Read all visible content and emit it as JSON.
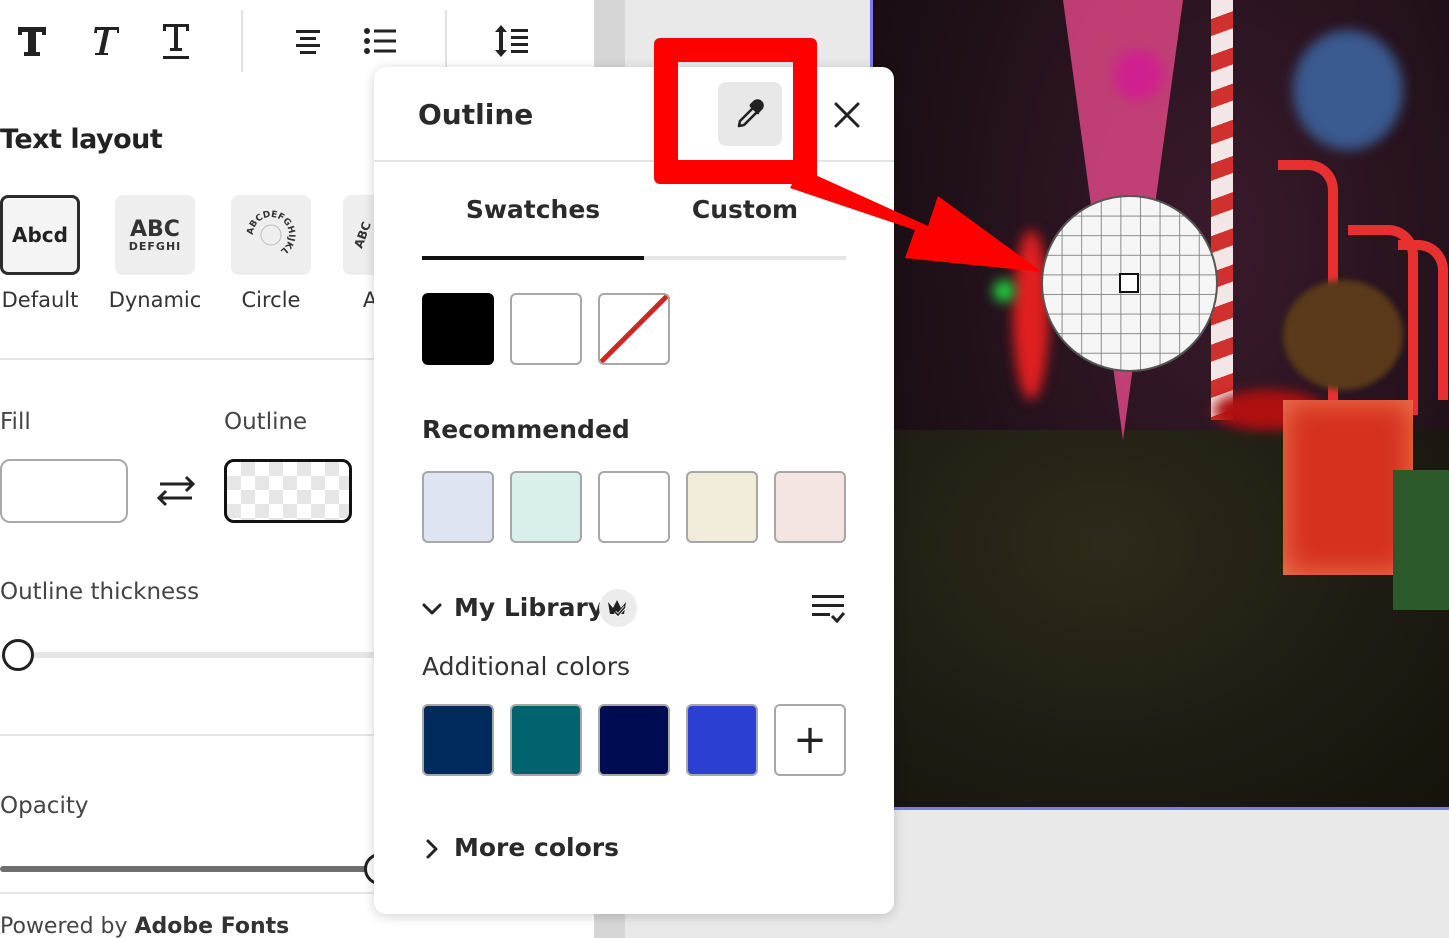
{
  "toolbar": {
    "icons": [
      "bold-text-icon",
      "italic-text-icon",
      "underline-text-icon",
      "align-center-icon",
      "bulleted-list-icon",
      "line-spacing-icon"
    ]
  },
  "text_layout": {
    "title": "Text layout",
    "options": [
      {
        "label": "Default",
        "preview": "Abcd",
        "selected": true
      },
      {
        "label": "Dynamic",
        "preview": "ABC",
        "preview_sub": "DEFGHI",
        "selected": false
      },
      {
        "label": "Circle",
        "preview": "ABCDEFGHIJKL",
        "selected": false
      },
      {
        "label": "A",
        "preview": "ABC",
        "selected": false
      }
    ]
  },
  "fill_outline": {
    "fill_label": "Fill",
    "outline_label": "Outline",
    "fill_color": "#ffffff",
    "outline_color": "transparent"
  },
  "outline_thickness": {
    "label": "Outline thickness",
    "value_fraction": 0.0
  },
  "opacity": {
    "label": "Opacity",
    "value_fraction": 1.0
  },
  "footer": {
    "prefix": "Powered by ",
    "brand": "Adobe Fonts"
  },
  "popover": {
    "title": "Outline",
    "eyedropper": "eyedropper-icon",
    "close": "close-icon",
    "tabs": [
      {
        "label": "Swatches",
        "active": true
      },
      {
        "label": "Custom",
        "active": false
      }
    ],
    "swatches": [
      "#000000",
      "#ffffff",
      "none"
    ],
    "recommended_label": "Recommended",
    "recommended": [
      "#dfe4f3",
      "#d9efec",
      "#ffffff",
      "#f1ecda",
      "#f4e4e2"
    ],
    "library_label": "My Library",
    "additional_label": "Additional colors",
    "additional": [
      "#002a5c",
      "#00636d",
      "#000c52",
      "#2b40d2"
    ],
    "add_color": "+",
    "more_colors_label": "More colors"
  },
  "accent_colors": {
    "annotation_red": "#ff0000",
    "selection_border": "#7b7bf0"
  }
}
